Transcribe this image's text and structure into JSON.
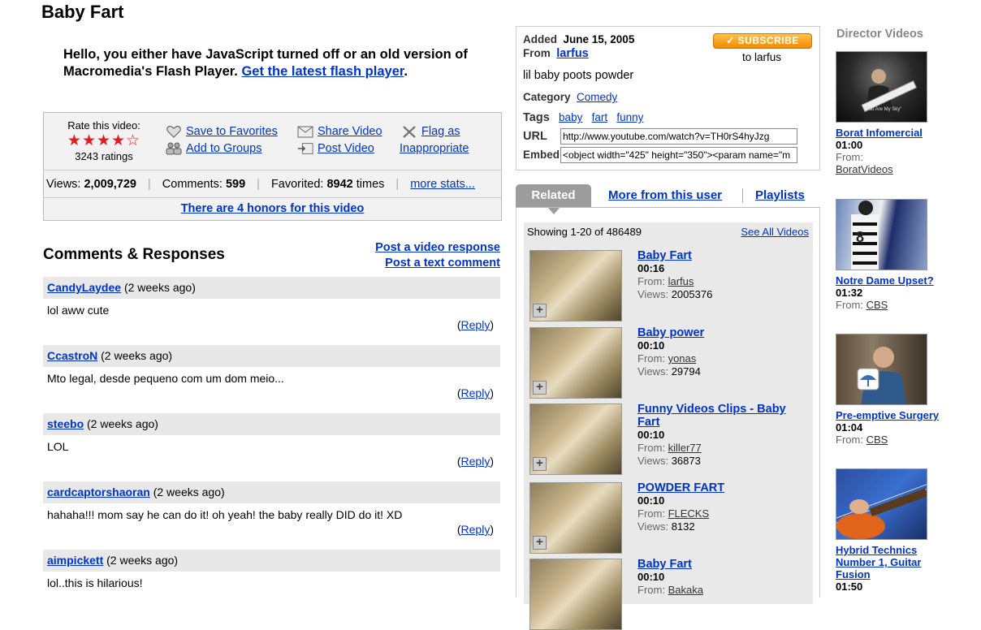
{
  "video": {
    "title": "Baby Fart"
  },
  "flash_message": {
    "text": "Hello, you either have JavaScript turned off or an old version of Macromedia's Flash Player.",
    "link": "Get the latest flash player",
    "suffix": "."
  },
  "rating": {
    "label": "Rate this video:",
    "stars_full": "★★★★",
    "stars_empty": "☆",
    "count": "3243 ratings"
  },
  "actions": {
    "save": "Save to Favorites",
    "groups": "Add to Groups",
    "share": "Share Video",
    "post": "Post Video",
    "flag": "Flag as",
    "flag2": "Inappropriate"
  },
  "stats": {
    "views_label": "Views:",
    "views": "2,009,729",
    "comments_label": "Comments:",
    "comments": "599",
    "favorited_label": "Favorited:",
    "favorited": "8942",
    "favorited_suffix": "times",
    "more": "more stats...",
    "honors": "There are 4 honors for this video",
    "sep": "|"
  },
  "comments": {
    "title": "Comments & Responses",
    "post_video": "Post a video response",
    "post_text": "Post a text comment",
    "reply_label": "Reply",
    "items": [
      {
        "user": "CandyLaydee",
        "time": "(2 weeks ago)",
        "text": "lol aww cute"
      },
      {
        "user": "CcastroN",
        "time": "(2 weeks ago)",
        "text": "Mto legal, desde pequeno com um dom meio..."
      },
      {
        "user": "steebo",
        "time": "(2 weeks ago)",
        "text": "LOL"
      },
      {
        "user": "cardcaptorshaoran",
        "time": "(2 weeks ago)",
        "text": "hahaha!!! mom say he can do it! oh yeah! the baby really DID do it! XD"
      },
      {
        "user": "aimpickett",
        "time": "(2 weeks ago)",
        "text": "lol..this is hilarious!"
      }
    ]
  },
  "info": {
    "added_label": "Added",
    "added": "June 15, 2005",
    "from_label": "From",
    "from": "larfus",
    "subscribe": "✓ SUBSCRIBE",
    "subscribe_to": "to larfus",
    "description": "lil baby poots powder",
    "category_label": "Category",
    "category": "Comedy",
    "tags_label": "Tags",
    "tags": [
      "baby",
      "fart",
      "funny"
    ],
    "url_label": "URL",
    "url": "http://www.youtube.com/watch?v=TH0rS4hyJzg",
    "embed_label": "Embed",
    "embed": "<object width=\"425\" height=\"350\"><param name=\"m"
  },
  "tabs": {
    "related": "Related",
    "more": "More from this user",
    "playlists": "Playlists"
  },
  "related": {
    "showing": "Showing 1-20 of 486489",
    "see_all": "See All Videos",
    "from_label": "From:",
    "views_label": "Views:",
    "items": [
      {
        "title": "Baby Fart",
        "duration": "00:16",
        "from": "larfus",
        "views": "2005376"
      },
      {
        "title": "Baby power",
        "duration": "00:10",
        "from": "yonas",
        "views": "29794"
      },
      {
        "title": "Funny Videos Clips - Baby Fart",
        "duration": "00:10",
        "from": "killer77",
        "views": "36873"
      },
      {
        "title": "POWDER FART",
        "duration": "00:10",
        "from": "FLECKS",
        "views": "8132"
      },
      {
        "title": "Baby Fart",
        "duration": "00:10",
        "from": "Bakaka",
        "views": ""
      }
    ]
  },
  "director": {
    "title": "Director Videos",
    "from_label": "From:",
    "items": [
      {
        "title": "Borat Infomercial",
        "duration": "01:00",
        "from": "BoratVideos",
        "thumb_caption": "\"You Are My Sky\""
      },
      {
        "title": "Notre Dame Upset?",
        "duration": "01:32",
        "from": "CBS"
      },
      {
        "title": "Pre-emptive Surgery",
        "duration": "01:04",
        "from": "CBS"
      },
      {
        "title": "Hybrid Technics Number 1, Guitar Fusion",
        "duration": "01:50",
        "from": ""
      }
    ]
  }
}
